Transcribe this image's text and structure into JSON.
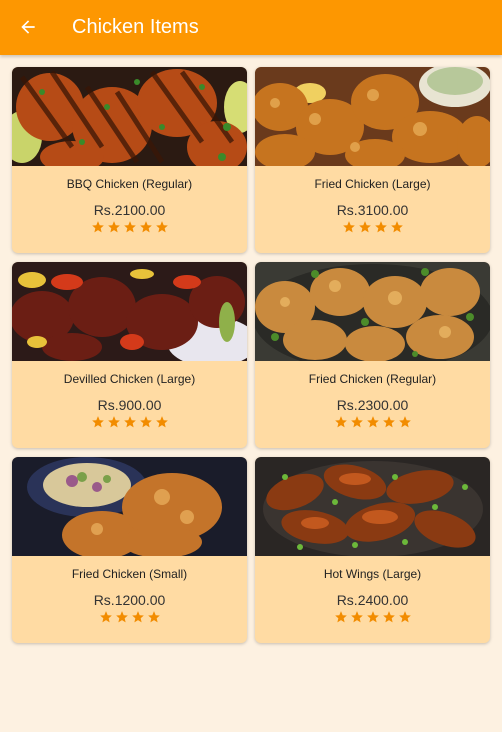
{
  "appbar": {
    "title": "Chicken Items",
    "back_icon": "arrow-left-icon",
    "color": "#fd9701"
  },
  "theme": {
    "background": "#fdf1e1",
    "card": "#ffdba3",
    "star": "#f28c00"
  },
  "items": [
    {
      "name": "BBQ Chicken (Regular)",
      "price": "Rs.2100.00",
      "rating": 5,
      "image": "bbq-chicken-image"
    },
    {
      "name": "Fried Chicken (Large)",
      "price": "Rs.3100.00",
      "rating": 4,
      "image": "fried-chicken-large-image"
    },
    {
      "name": "Devilled Chicken (Large)",
      "price": "Rs.900.00",
      "rating": 5,
      "image": "devilled-chicken-image"
    },
    {
      "name": "Fried Chicken (Regular)",
      "price": "Rs.2300.00",
      "rating": 5,
      "image": "fried-chicken-regular-image"
    },
    {
      "name": "Fried Chicken (Small)",
      "price": "Rs.1200.00",
      "rating": 4,
      "image": "fried-chicken-small-image"
    },
    {
      "name": "Hot Wings (Large)",
      "price": "Rs.2400.00",
      "rating": 5,
      "image": "hot-wings-image"
    }
  ]
}
